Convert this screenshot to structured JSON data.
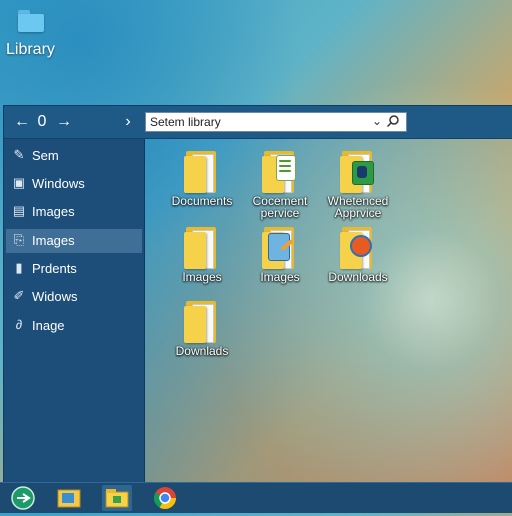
{
  "desktop": {
    "icon_label": "Library"
  },
  "window": {
    "address": "Setem library",
    "nav": {
      "back": "←",
      "stop": "0",
      "forward": "→",
      "up": "›"
    }
  },
  "sidebar": {
    "items": [
      {
        "label": "Sem",
        "icon": "pin-icon"
      },
      {
        "label": "Windows",
        "icon": "lock-icon"
      },
      {
        "label": "Images",
        "icon": "document-icon"
      },
      {
        "label": "Images",
        "icon": "image-icon",
        "selected": true
      },
      {
        "label": "Prdents",
        "icon": "book-icon"
      },
      {
        "label": "Widows",
        "icon": "tool-icon"
      },
      {
        "label": "Inage",
        "icon": "link-icon"
      }
    ]
  },
  "files": [
    {
      "name": "Documents",
      "icon": "folder-icon"
    },
    {
      "name": "Cocement pervice",
      "icon": "document-folder-icon"
    },
    {
      "name": "Whetenced Apprvice",
      "icon": "app-folder-icon"
    },
    {
      "name": "Images",
      "icon": "folder-icon"
    },
    {
      "name": "Images",
      "icon": "picture-folder-icon"
    },
    {
      "name": "Downloads",
      "icon": "browser-folder-icon"
    },
    {
      "name": "Downlads",
      "icon": "folder-icon"
    }
  ],
  "taskbar": {
    "items": [
      "start-icon",
      "folder-map-icon",
      "file-explorer-icon",
      "chrome-icon"
    ]
  }
}
